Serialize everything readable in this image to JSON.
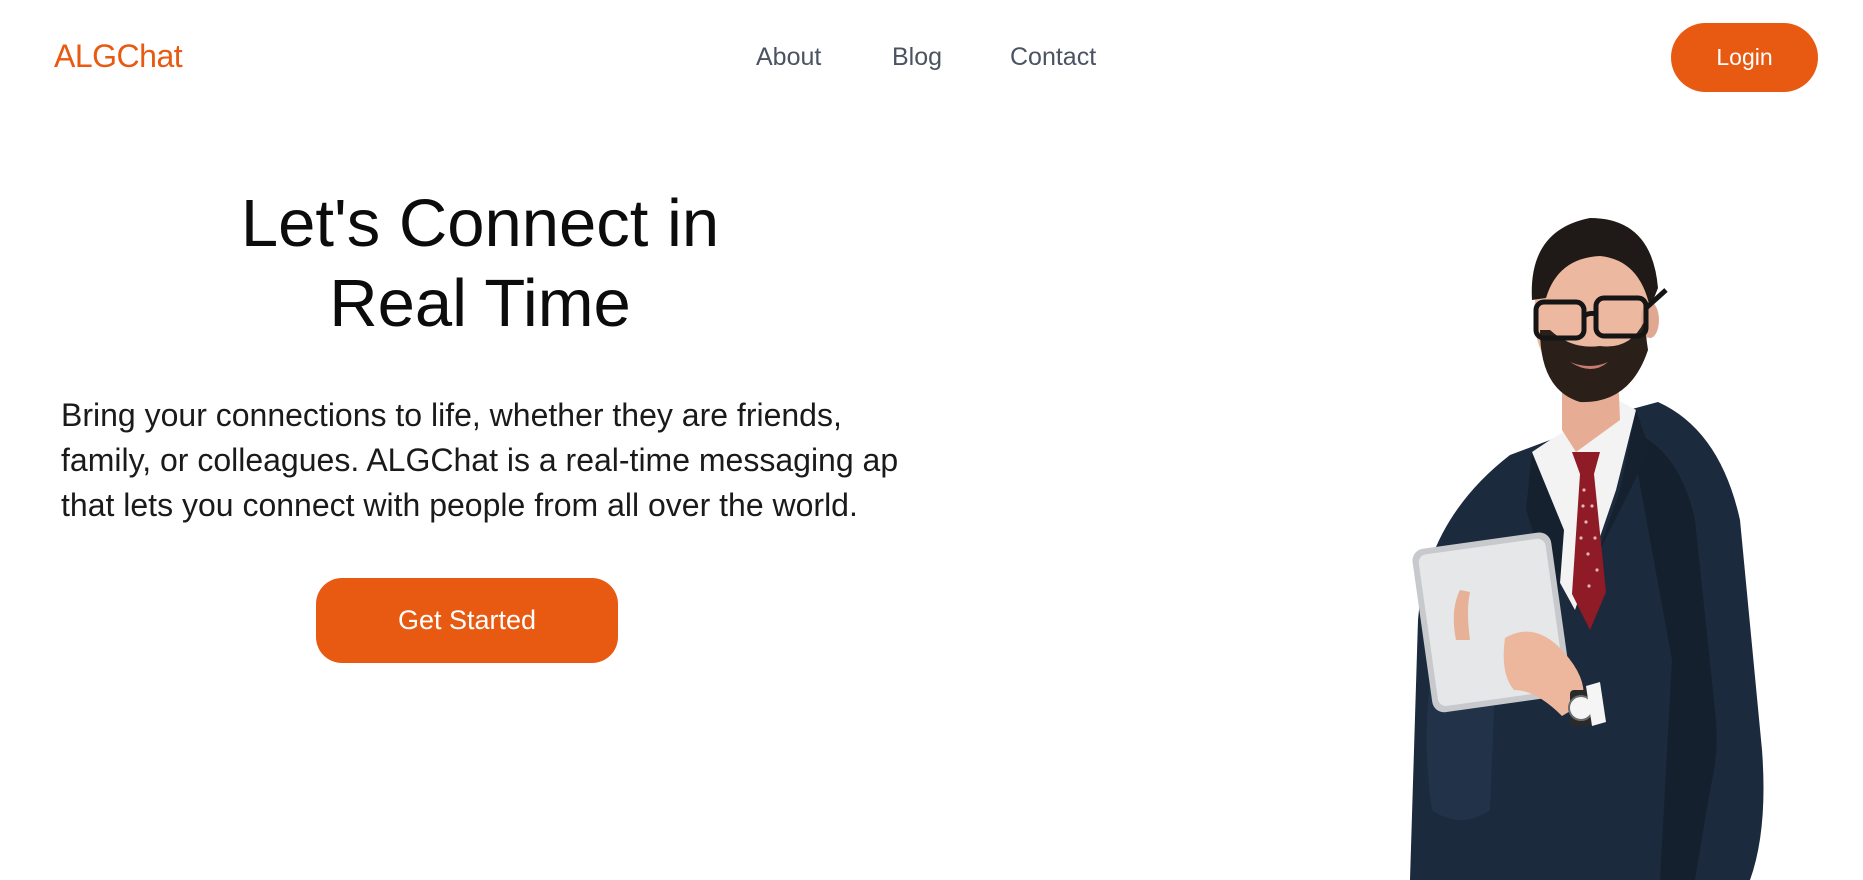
{
  "header": {
    "logo": "ALGChat",
    "nav": {
      "about": "About",
      "blog": "Blog",
      "contact": "Contact"
    },
    "login_label": "Login"
  },
  "hero": {
    "title_lines": [
      "Let's Connect in",
      "Real Time"
    ],
    "description_lines": [
      "Bring your connections to life, whether they are friends,",
      "family, or colleagues. ALGChat is a real-time messaging ap",
      "that lets you connect with people from all over the world."
    ],
    "cta_label": "Get Started"
  },
  "image": {
    "subject": "businessman-with-tablet"
  },
  "colors": {
    "accent": "#e85a12",
    "nav_text": "#4a5361",
    "heading_text": "#0c0c0c",
    "background": "#ffffff"
  }
}
